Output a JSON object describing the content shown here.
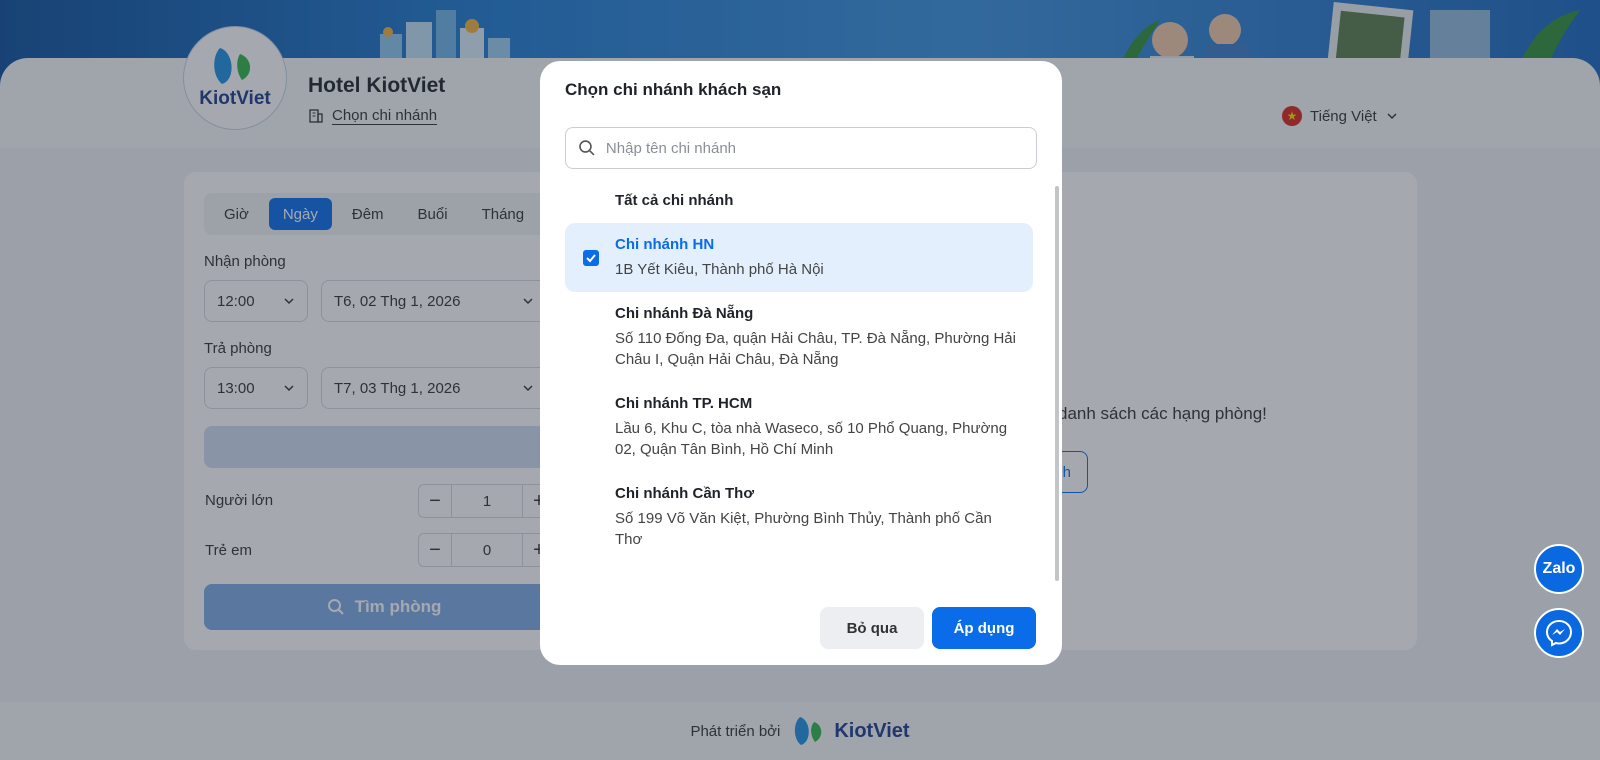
{
  "hotel": {
    "logo_text": "KiotViet",
    "name": "Hotel KiotViet",
    "choose_branch_label": "Chọn chi nhánh"
  },
  "language": {
    "label": "Tiếng Việt",
    "flag": "vietnam-flag-icon"
  },
  "booking_form": {
    "tabs": [
      "Giờ",
      "Ngày",
      "Đêm",
      "Buổi",
      "Tháng"
    ],
    "active_tab": "Ngày",
    "checkin_label": "Nhận phòng",
    "checkin_time": "12:00",
    "checkin_date": "T6, 02 Thg 1, 2026",
    "checkout_label": "Trả phòng",
    "checkout_time": "13:00",
    "checkout_date": "T7, 03 Thg 1, 2026",
    "adults_label": "Người lớn",
    "adults_value": "1",
    "children_label": "Trẻ em",
    "children_value": "0",
    "search_button": "Tìm phòng"
  },
  "right_panel": {
    "message": "danh sách các hạng phòng!",
    "button_fragment": "nh"
  },
  "footer": {
    "developed_by": "Phát triển bởi",
    "brand": "KiotViet"
  },
  "chat": {
    "zalo_label": "Zalo"
  },
  "modal": {
    "title": "Chọn chi nhánh khách sạn",
    "search_placeholder": "Nhập tên chi nhánh",
    "all_branches": "Tất cả chi nhánh",
    "branches": [
      {
        "name": "Chi nhánh HN",
        "address": "1B Yết Kiêu, Thành phố Hà Nội",
        "selected": true
      },
      {
        "name": "Chi nhánh Đà Nẵng",
        "address": "Số 110 Đống Đa, quận Hải Châu, TP. Đà Nẵng, Phường Hải Châu I, Quận Hải Châu, Đà Nẵng",
        "selected": false
      },
      {
        "name": "Chi nhánh TP. HCM",
        "address": "Lầu 6, Khu C, tòa nhà Waseco, số 10 Phổ Quang, Phường 02, Quận Tân Bình, Hồ Chí Minh",
        "selected": false
      },
      {
        "name": "Chi nhánh Cần Thơ",
        "address": "Số 199 Võ Văn Kiệt, Phường Bình Thủy, Thành phố Cần Thơ",
        "selected": false
      }
    ],
    "cancel_label": "Bỏ qua",
    "apply_label": "Áp dụng"
  },
  "colors": {
    "primary": "#0a6ce8",
    "selected_bg": "#e4effd",
    "brand_dark": "#1c3b8b"
  }
}
